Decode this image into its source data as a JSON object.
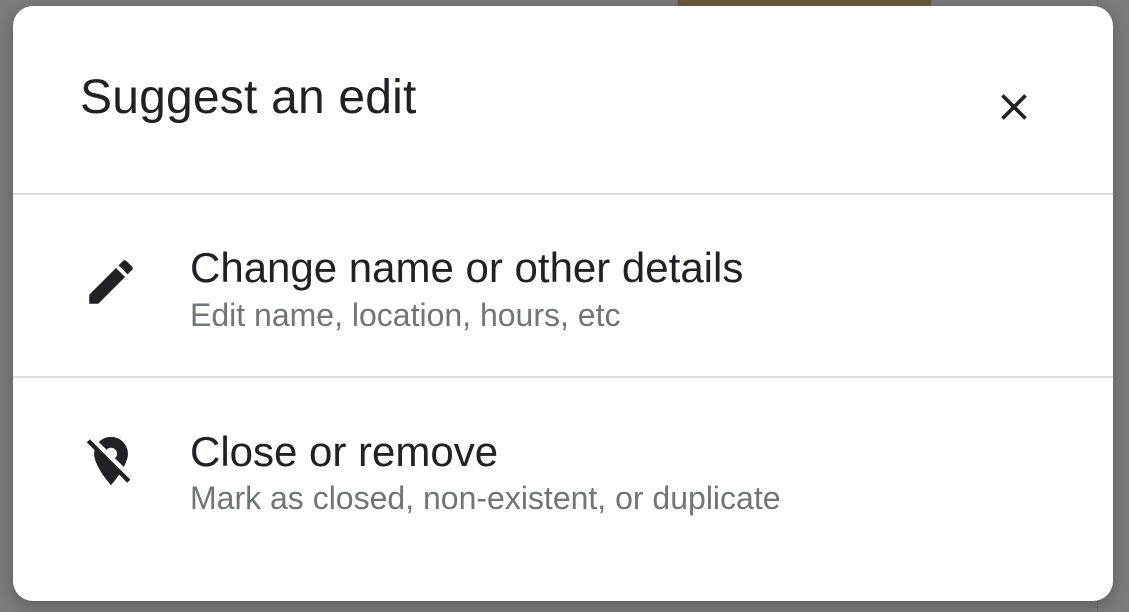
{
  "dialog": {
    "title": "Suggest an edit",
    "close_icon": "close-icon",
    "options": [
      {
        "icon": "pencil-icon",
        "title": "Change name or other details",
        "subtitle": "Edit name, location, hours, etc"
      },
      {
        "icon": "location-off-icon",
        "title": "Close or remove",
        "subtitle": "Mark as closed, non-existent, or duplicate"
      }
    ]
  },
  "colors": {
    "overlay": "#7b7b7b",
    "dialog_bg": "#ffffff",
    "title_text": "#202124",
    "secondary_text": "#70757a",
    "divider": "#dadce0"
  }
}
